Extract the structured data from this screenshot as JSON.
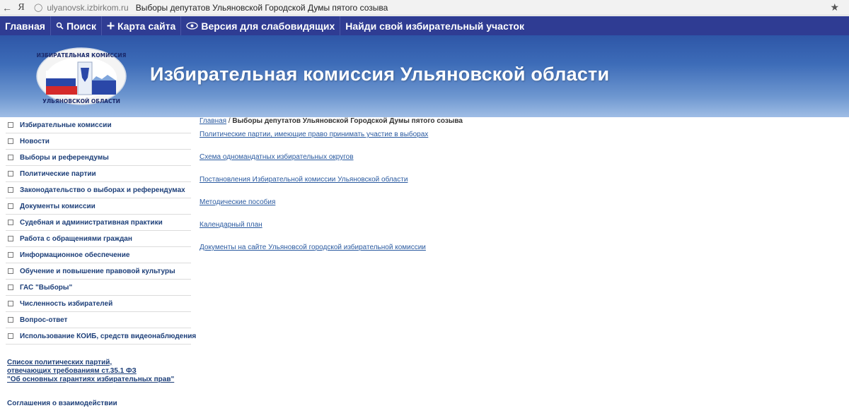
{
  "browser": {
    "back_icon": "back-arrow-icon",
    "logo": "Я",
    "url": "ulyanovsk.izbirkom.ru",
    "tab_title": "Выборы депутатов Ульяновской Городской Думы пятого созыва",
    "star_icon": "star-icon"
  },
  "topnav": {
    "items": [
      {
        "label": "Главная",
        "icon": ""
      },
      {
        "label": "Поиск",
        "icon": "search-icon"
      },
      {
        "label": "Карта сайта",
        "icon": "plus-icon"
      },
      {
        "label": "Версия для слабовидящих",
        "icon": "eye-icon"
      },
      {
        "label": "Найди свой избирательный участок",
        "icon": ""
      }
    ]
  },
  "header": {
    "title": "Избирательная комиссия Ульяновской области",
    "logo_text_top": "ИЗБИРАТЕЛЬНАЯ КОМИССИЯ",
    "logo_text_bottom": "УЛЬЯНОВСКОЙ ОБЛАСТИ"
  },
  "sidebar": {
    "items": [
      "Избирательные комиссии",
      "Новости",
      "Выборы и референдумы",
      "Политические партии",
      "Законодательство о выборах и референдумах",
      "Документы комиссии",
      "Судебная и административная практики",
      "Работа с обращениями граждан",
      "Информационное обеспечение",
      "Обучение и повышение правовой культуры",
      "ГАС \"Выборы\"",
      "Численность избирателей",
      "Вопрос-ответ",
      "Использование КОИБ, средств видеонаблюдения"
    ],
    "party_list_link": [
      "Список политических партий,",
      "отвечающих требованиям ст.35.1 ФЗ",
      "\"Об основных гарантиях избирательных прав\""
    ],
    "agreements": "Соглашения о взаимодействии"
  },
  "main": {
    "breadcrumb": {
      "home": "Главная",
      "separator": " / ",
      "current": "Выборы депутатов Ульяновской Городской Думы пятого созыва"
    },
    "links": [
      "Политические партии, имеющие право принимать участие в выборах",
      "Схема одномандатных избирательных округов",
      "Постановления Избирательной комиссии Ульяновской области",
      "Методические пособия",
      "Календарный план",
      "Документы на сайте Ульяновсой городской избирательной комиссии"
    ]
  },
  "colors": {
    "nav_bg": "#2f3c93",
    "link": "#2a5aa0",
    "menu_text": "#1d3f79"
  }
}
